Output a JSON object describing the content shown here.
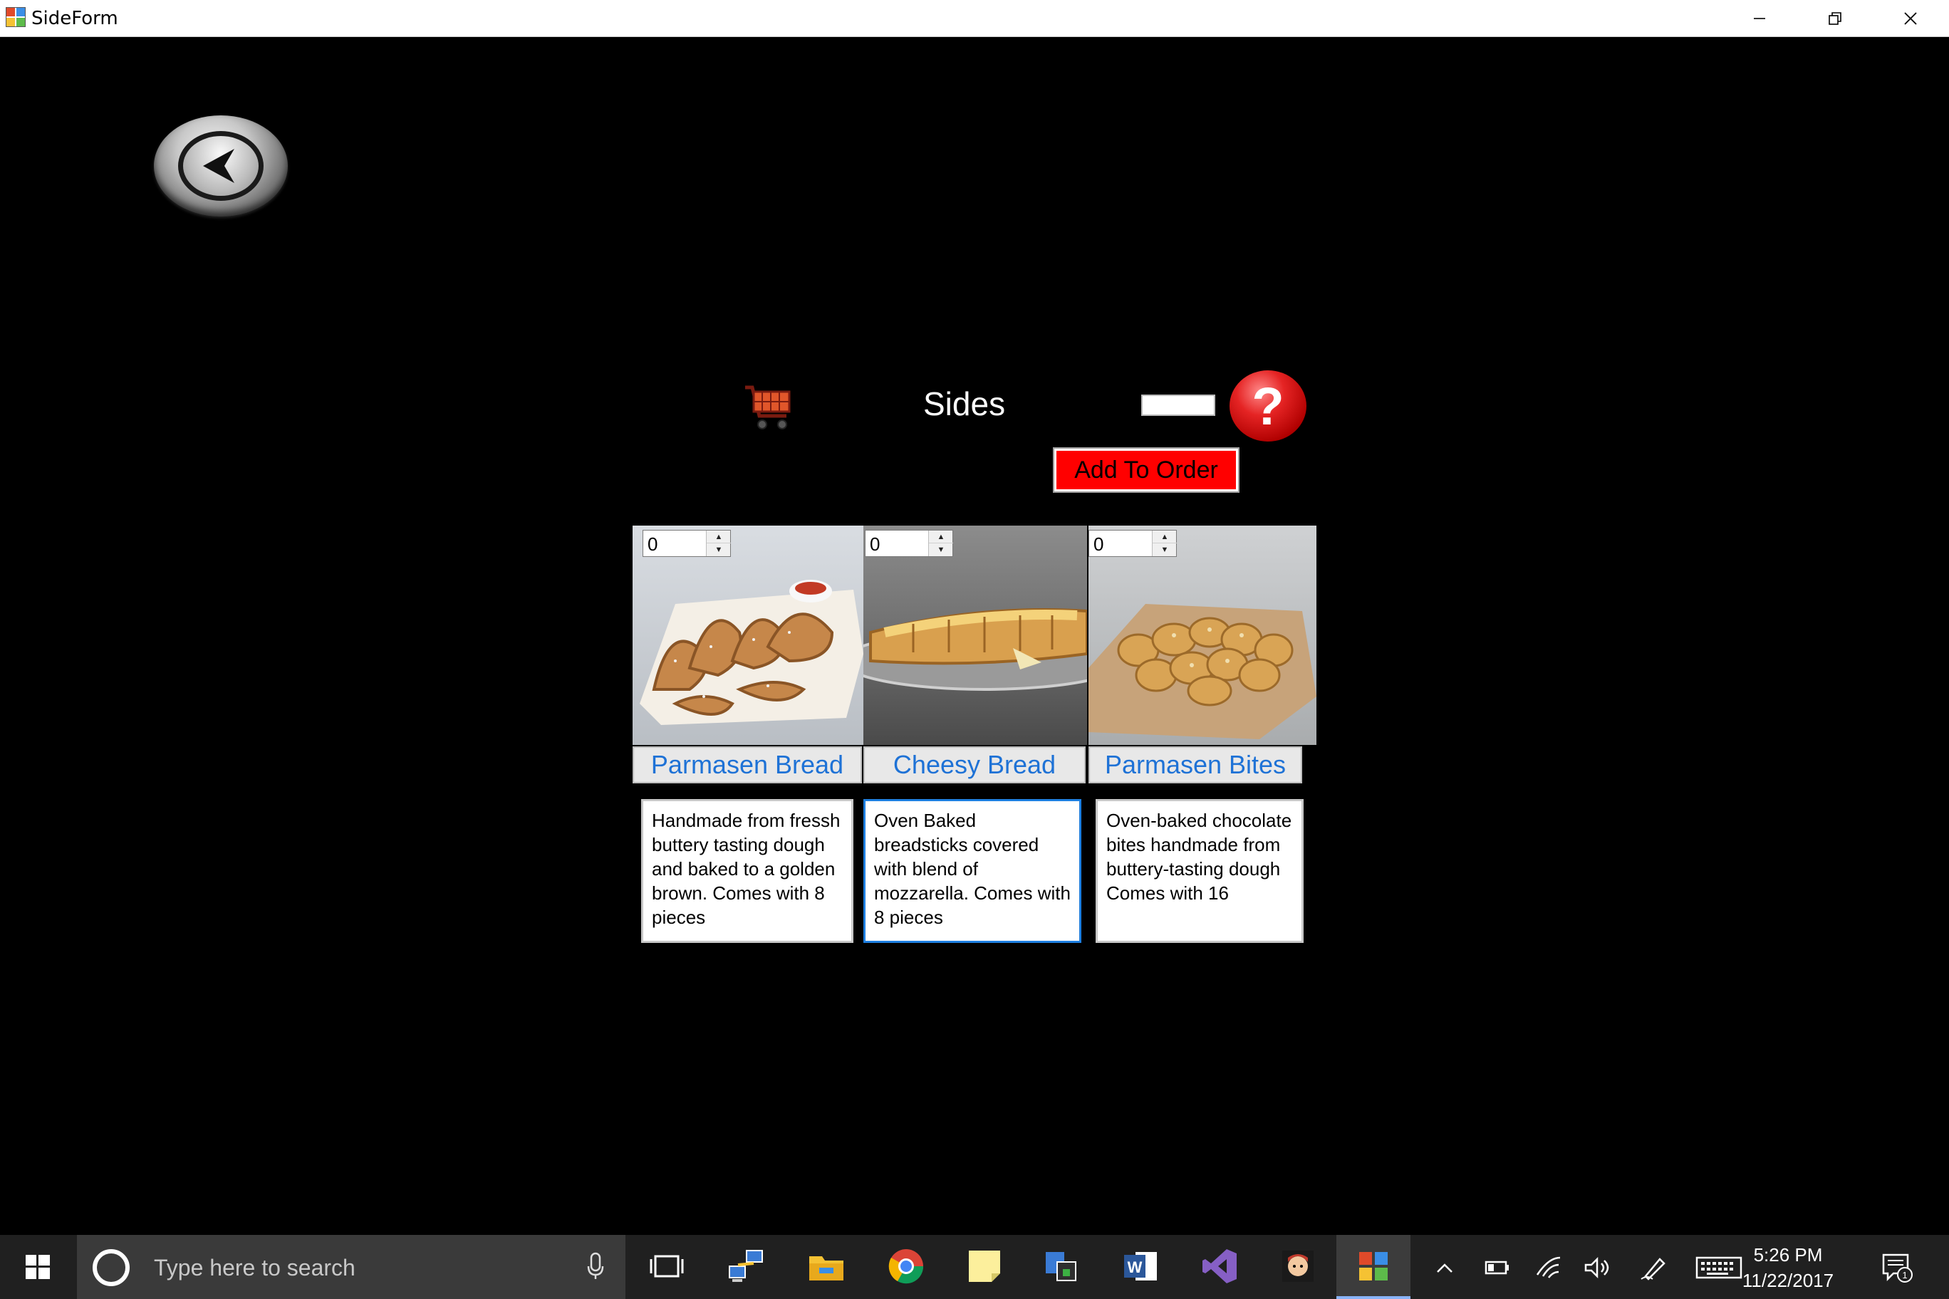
{
  "window": {
    "title": "SideForm",
    "minimize_icon": "minimize-icon",
    "restore_icon": "restore-icon",
    "close_icon": "close-icon"
  },
  "page": {
    "title": "Sides",
    "add_to_order_label": "Add To Order",
    "help_label": "?",
    "total_value": ""
  },
  "products": [
    {
      "name": "Parmasen Bread",
      "quantity": "0",
      "description": "Handmade from fressh buttery tasting dough and baked to a golden brown. Comes with 8 pieces"
    },
    {
      "name": "Cheesy Bread",
      "quantity": "0",
      "description": "Oven Baked breadsticks covered with blend of mozzarella. Comes with 8 pieces"
    },
    {
      "name": "Parmasen Bites",
      "quantity": "0",
      "description": "Oven-baked chocolate bites handmade from buttery-tasting dough Comes with 16"
    }
  ],
  "taskbar": {
    "search_placeholder": "Type here to search",
    "time": "5:26 PM",
    "date": "11/22/2017",
    "notification_count": "1",
    "pinned_apps": [
      "task-view",
      "network-app",
      "file-explorer",
      "chrome",
      "sticky-notes",
      "security-app",
      "word",
      "visual-studio",
      "game-app",
      "sideform-app"
    ]
  },
  "colors": {
    "accent_red": "#ff0000",
    "label_blue": "#1e72d6",
    "background": "#000000",
    "taskbar": "#202020"
  }
}
